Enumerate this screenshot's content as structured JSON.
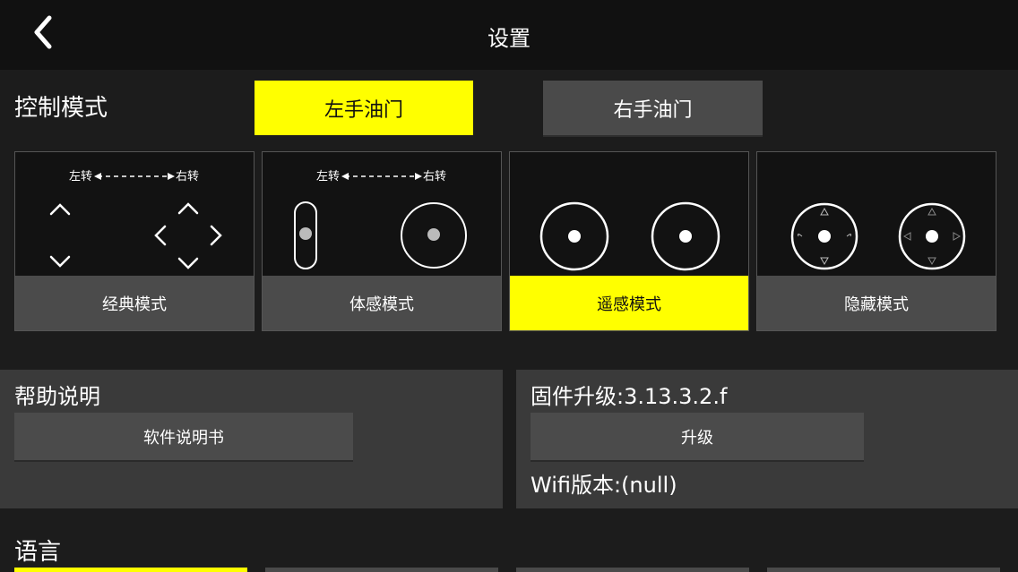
{
  "header": {
    "title": "设置",
    "back_icon": "chevron-left-icon"
  },
  "control_mode": {
    "label": "控制模式",
    "left_hand": "左手油门",
    "right_hand": "右手油门",
    "selected": "left_hand"
  },
  "modes": [
    {
      "label": "经典模式",
      "turn_left": "左转",
      "turn_right": "右转"
    },
    {
      "label": "体感模式",
      "turn_left": "左转",
      "turn_right": "右转"
    },
    {
      "label": "遥感模式"
    },
    {
      "label": "隐藏模式"
    }
  ],
  "selected_mode": "遥感模式",
  "help": {
    "title": "帮助说明",
    "manual_button": "软件说明书"
  },
  "firmware": {
    "title": "固件升级:3.13.3.2.f",
    "upgrade_button": "升级",
    "wifi_version": "Wifi版本:(null)"
  },
  "language": {
    "label": "语言"
  },
  "colors": {
    "accent": "#ffff00",
    "background": "#1c1c1c",
    "header": "#111111",
    "button": "#4b4b4b",
    "panel": "#3a3a3a"
  }
}
